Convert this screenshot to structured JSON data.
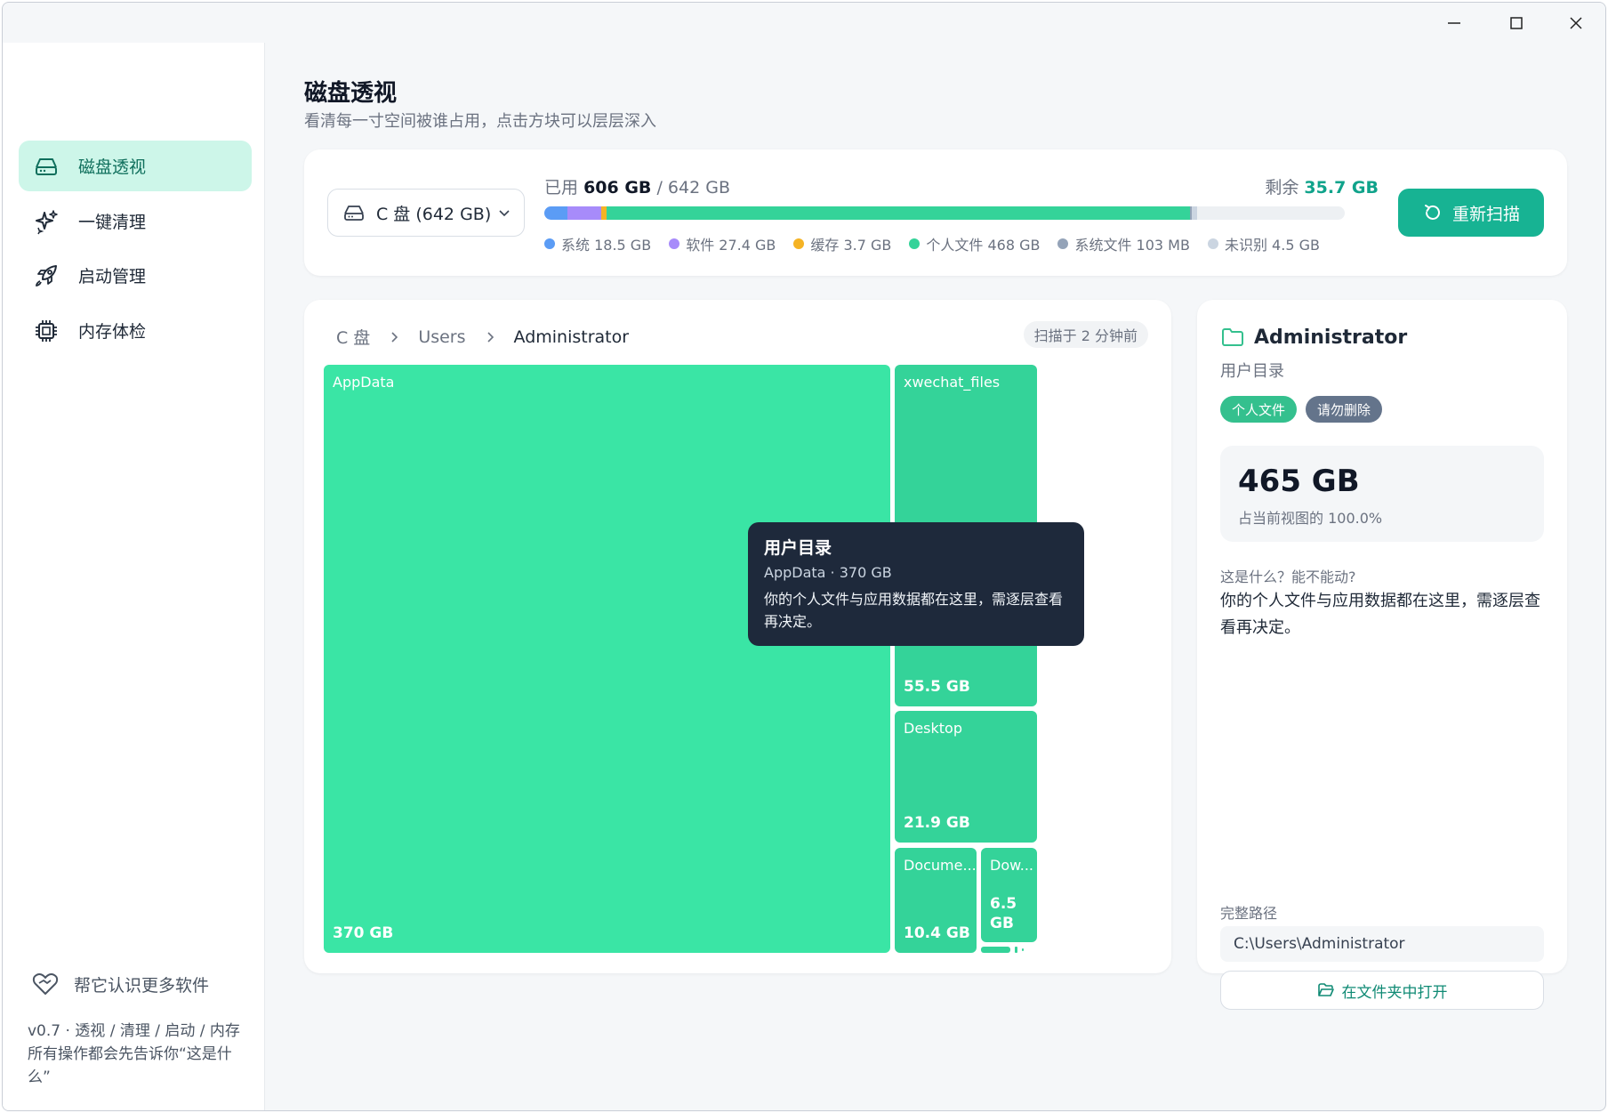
{
  "sidebar": {
    "nav": [
      {
        "label": "磁盘透视",
        "icon": "hard-drive-icon"
      },
      {
        "label": "一键清理",
        "icon": "sparkles-icon"
      },
      {
        "label": "启动管理",
        "icon": "rocket-icon"
      },
      {
        "label": "内存体检",
        "icon": "cpu-chip-icon"
      }
    ],
    "active_index": 0,
    "help_label": "帮它认识更多软件",
    "version_text": "v0.7 · 透视 / 清理 / 启动 / 内存 所有操作都会先告诉你“这是什么”"
  },
  "header": {
    "title": "磁盘透视",
    "subtitle": "看清每一寸空间被谁占用，点击方块可以层层深入"
  },
  "disk": {
    "selector_label": "C 盘 (642 GB)",
    "used_prefix": "已用",
    "used": "606 GB",
    "total": "/ 642 GB",
    "remain_prefix": "剩余",
    "remain": "35.7 GB",
    "rescan_label": "重新扫描",
    "segments": [
      {
        "name": "系统",
        "label": "系统 18.5 GB",
        "gb": 18.5,
        "color": "#5b9cf5"
      },
      {
        "name": "软件",
        "label": "软件 27.4 GB",
        "gb": 27.4,
        "color": "#a78bfa"
      },
      {
        "name": "缓存",
        "label": "缓存 3.7 GB",
        "gb": 3.7,
        "color": "#f5b324"
      },
      {
        "name": "个人文件",
        "label": "个人文件 468 GB",
        "gb": 468,
        "color": "#34d399"
      },
      {
        "name": "系统文件",
        "label": "系统文件 103 MB",
        "gb": 0.1,
        "color": "#94a3b8"
      },
      {
        "name": "未识别",
        "label": "未识别 4.5 GB",
        "gb": 4.5,
        "color": "#cbd5e1"
      }
    ],
    "total_gb": 642
  },
  "breadcrumb": {
    "items": [
      "C 盘",
      "Users",
      "Administrator"
    ],
    "scan_time": "扫描于 2 分钟前"
  },
  "treemap": {
    "tiles": [
      {
        "name": "AppData",
        "size": "370 GB",
        "color": "#3ae5a5"
      },
      {
        "name": "xwechat_files",
        "size": "55.5 GB",
        "color": "#34d399"
      },
      {
        "name": "Desktop",
        "size": "21.9 GB",
        "color": "#34d399"
      },
      {
        "name": "Docume...",
        "size": "10.4 GB",
        "color": "#34d399"
      },
      {
        "name": "Dow...",
        "size": "6.5 GB",
        "color": "#34d399"
      }
    ],
    "small_tile_color": "#34d399"
  },
  "tooltip": {
    "title": "用户目录",
    "line": "AppData · 370 GB",
    "desc": "你的个人文件与应用数据都在这里，需逐层查看再决定。"
  },
  "detail": {
    "title": "Administrator",
    "subtitle": "用户目录",
    "tags": [
      {
        "label": "个人文件",
        "color": "#34c08e"
      },
      {
        "label": "请勿删除",
        "color": "#64748b"
      }
    ],
    "size": "465 GB",
    "percent_text": "占当前视图的 100.0%",
    "question": "这是什么？能不能动?",
    "answer": "你的个人文件与应用数据都在这里，需逐层查看再决定。",
    "path_label": "完整路径",
    "path": "C:\\Users\\Administrator",
    "open_label": "在文件夹中打开"
  }
}
